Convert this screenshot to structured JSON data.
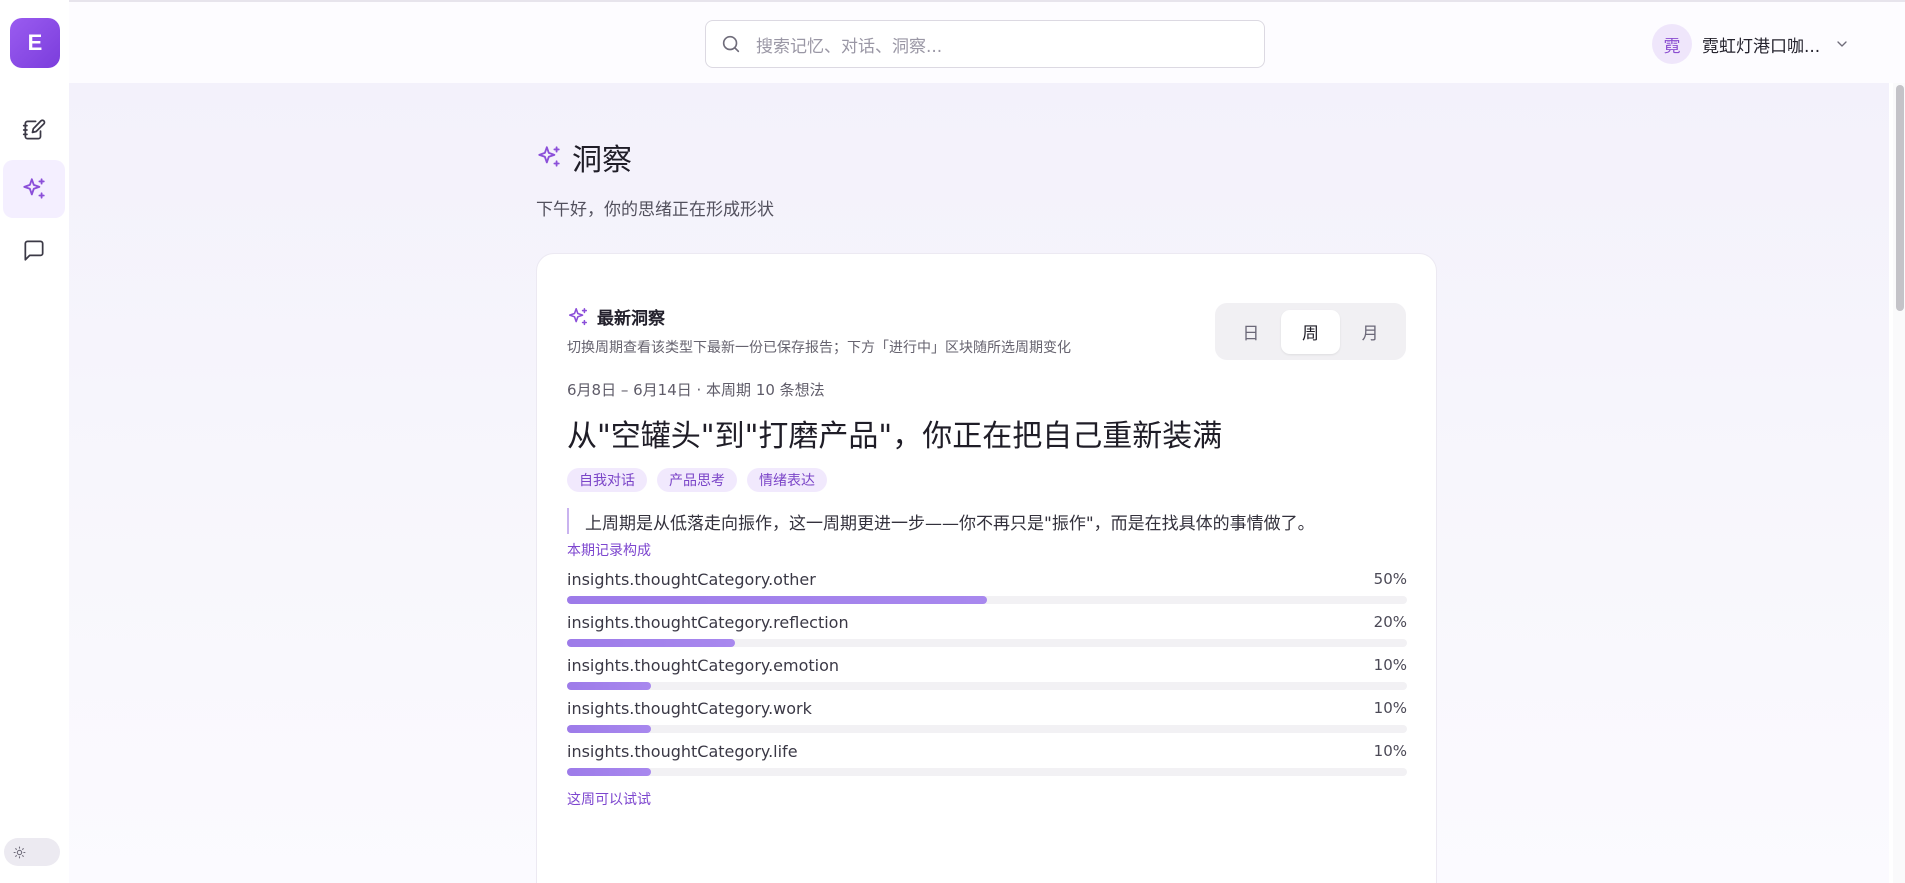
{
  "app": {
    "logo_letter": "E"
  },
  "sidebar": {
    "items": [
      {
        "name": "journal",
        "icon": "notebook-pen-icon"
      },
      {
        "name": "insights",
        "icon": "sparkles-icon",
        "active": true
      },
      {
        "name": "chat",
        "icon": "message-square-icon"
      }
    ]
  },
  "search": {
    "placeholder": "搜索记忆、对话、洞察..."
  },
  "user": {
    "avatar_char": "霓",
    "name": "霓虹灯港口咖..."
  },
  "page": {
    "title": "洞察",
    "subtitle": "下午好，你的思绪正在形成形状"
  },
  "card": {
    "title": "最新洞察",
    "description": "切换周期查看该类型下最新一份已保存报告；下方「进行中」区块随所选周期变化",
    "period_options": [
      "日",
      "周",
      "月"
    ],
    "period_selected": "周",
    "period_text": "6月8日 – 6月14日 · 本周期 10 条想法",
    "headline": "从\"空罐头\"到\"打磨产品\"，你正在把自己重新装满",
    "tags": [
      "自我对话",
      "产品思考",
      "情绪表达"
    ],
    "quote": "上周期是从低落走向振作，这一周期更进一步——你不再只是\"振作\"，而是在找具体的事情做了。",
    "composition_label": "本期记录构成",
    "composition": [
      {
        "label": "insights.thoughtCategory.other",
        "percent_text": "50%",
        "value": 50
      },
      {
        "label": "insights.thoughtCategory.reflection",
        "percent_text": "20%",
        "value": 20
      },
      {
        "label": "insights.thoughtCategory.emotion",
        "percent_text": "10%",
        "value": 10
      },
      {
        "label": "insights.thoughtCategory.work",
        "percent_text": "10%",
        "value": 10
      },
      {
        "label": "insights.thoughtCategory.life",
        "percent_text": "10%",
        "value": 10
      }
    ],
    "try_label": "这周可以试试"
  },
  "colors": {
    "accent": "#8b5cf6",
    "bar_fill": "#a183ea",
    "tag_bg": "#f1e9fd",
    "tag_text": "#7b45c8"
  }
}
